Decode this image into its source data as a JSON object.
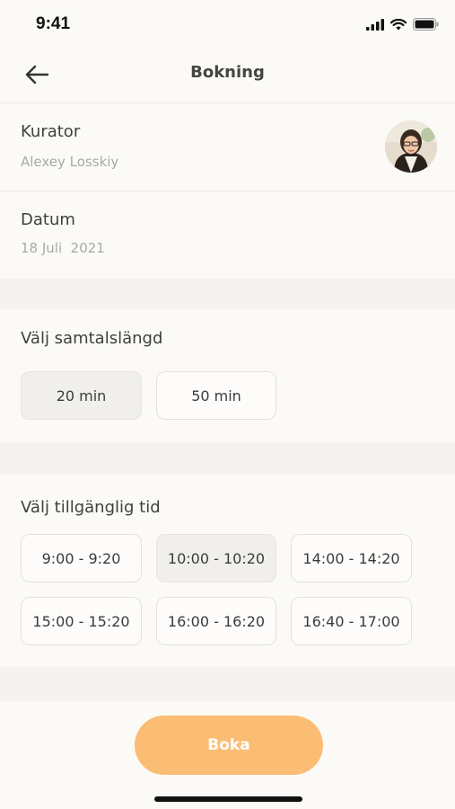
{
  "status": {
    "time": "9:41"
  },
  "header": {
    "title": "Bokning",
    "back_icon": "arrow-left-icon"
  },
  "counselor": {
    "label": "Kurator",
    "name": "Alexey Losskiy"
  },
  "date": {
    "label": "Datum",
    "value": "18 Juli  2021"
  },
  "duration": {
    "title": "Välj samtalslängd",
    "options": [
      {
        "label": "20 min",
        "selected": true
      },
      {
        "label": "50 min",
        "selected": false
      }
    ]
  },
  "times": {
    "title": "Välj tillgänglig tid",
    "slots": [
      {
        "label": "9:00 - 9:20",
        "selected": false
      },
      {
        "label": "10:00 - 10:20",
        "selected": true
      },
      {
        "label": "14:00 - 14:20",
        "selected": false
      },
      {
        "label": "15:00 - 15:20",
        "selected": false
      },
      {
        "label": "16:00 - 16:20",
        "selected": false
      },
      {
        "label": "16:40 - 17:00",
        "selected": false
      }
    ]
  },
  "action": {
    "book_label": "Boka"
  },
  "colors": {
    "accent": "#fbbd74",
    "background": "#fbfaf6",
    "selected": "#f1efeb"
  }
}
